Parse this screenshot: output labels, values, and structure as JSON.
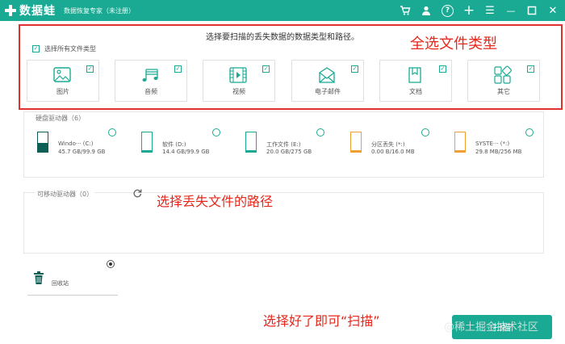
{
  "app": {
    "logo_text": "数据蛙",
    "subtitle": "数据恢复专家（未注册）"
  },
  "titlebar_icons": [
    "cart-icon",
    "user-icon",
    "help-icon",
    "plus-icon",
    "menu-icon",
    "minimize-icon",
    "close-icon"
  ],
  "titlebar_glyphs": {
    "help": "?",
    "plus": "+",
    "menu": "☰",
    "minimize": "—",
    "close": "✕"
  },
  "main": {
    "heading": "选择要扫描的丢失数据的数据类型和路径。",
    "select_all_label": "选择所有文件类型",
    "select_all_checked": true
  },
  "file_types": [
    {
      "label": "图片",
      "icon": "image-icon",
      "checked": true
    },
    {
      "label": "音频",
      "icon": "audio-icon",
      "checked": true
    },
    {
      "label": "视频",
      "icon": "video-icon",
      "checked": true
    },
    {
      "label": "电子邮件",
      "icon": "email-icon",
      "checked": true
    },
    {
      "label": "文档",
      "icon": "document-icon",
      "checked": true
    },
    {
      "label": "其它",
      "icon": "other-icon",
      "checked": true
    }
  ],
  "hard_drives": {
    "title": "硬盘驱动器（6）",
    "items": [
      {
        "name": "Windo··· (C:)",
        "size": "45.7 GB/99.9 GB",
        "type": "windows"
      },
      {
        "name": "软件 (D:)",
        "size": "14.4 GB/99.9 GB",
        "type": "partition"
      },
      {
        "name": "工作文件 (E:)",
        "size": "20.0 GB/275 GB",
        "type": "partition"
      },
      {
        "name": "分区丢失 (*:)",
        "size": "0.00  B/16.0 MB",
        "type": "lost"
      },
      {
        "name": "SYSTE··· (*:)",
        "size": "29.8 MB/256 MB",
        "type": "lost"
      }
    ]
  },
  "removable_drives": {
    "title": "可移动驱动器（0）"
  },
  "recycle_bin": {
    "label": "回收站",
    "selected": true
  },
  "scan_button": {
    "label": "扫描"
  },
  "annotations": {
    "select_types": "全选文件类型",
    "select_path": "选择丢失文件的路径",
    "scan_hint": "选择好了即可“扫描”"
  },
  "watermark": "@稀土掘金技术社区",
  "colors": {
    "brand": "#1aaa93",
    "annotation": "#e8261a",
    "warning": "#f0a030"
  }
}
